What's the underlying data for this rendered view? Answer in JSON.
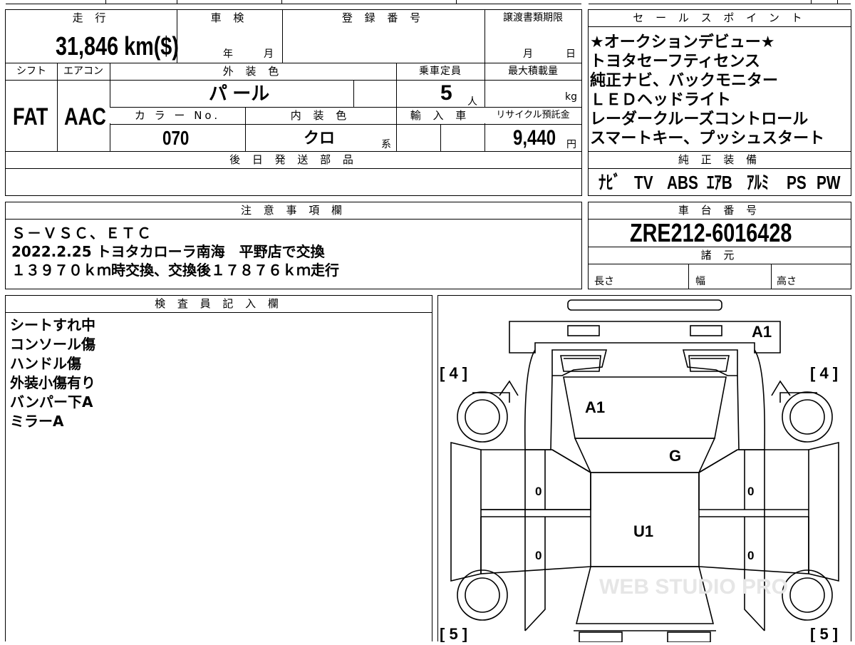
{
  "top": {
    "mileage_label": "走 行",
    "mileage_value": "31,846 km($)",
    "inspection_label": "車 検",
    "inspection_year": "年",
    "inspection_month": "月",
    "registration_label": "登 録 番 号",
    "transfer_label": "譲渡書類期限",
    "transfer_month": "月",
    "transfer_day": "日"
  },
  "row2": {
    "shift_label": "シフト",
    "ac_label": "エアコン",
    "exterior_color_label": "外 装 色",
    "capacity_label": "乗車定員",
    "max_load_label": "最大積載量",
    "shift_value": "FAT",
    "ac_value": "AAC",
    "exterior_color_value": "パ ール",
    "capacity_value": "5",
    "capacity_unit": "人",
    "max_load_unit": "kg",
    "color_no_label": "カ ラ ー No.",
    "interior_color_label": "内 装 色",
    "import_label": "輸 入 車",
    "recycle_label": "リサイクル預託金",
    "color_no_value": "070",
    "interior_color_value": "クロ",
    "interior_color_suffix": "系",
    "recycle_value": "9,440",
    "recycle_unit": "円",
    "later_parts_label": "後 日 発 送 部 品"
  },
  "sales": {
    "label": "セ ー ル ス ポ イ ン ト",
    "points": [
      "★オークションデビュー★",
      "トヨタセーフティセンス",
      "純正ナビ、バックモニター",
      "ＬＥＤヘッドライト",
      "レーダークルーズコントロール",
      "スマートキー、プッシュスタート"
    ],
    "equipment_label": "純 正 装 備",
    "equipment": [
      "ﾅﾋﾞ",
      "TV",
      "ABS",
      "ｴｱB",
      "ｱﾙﾐ",
      "PS",
      "PW"
    ]
  },
  "notes": {
    "label": "注 意 事 項 欄",
    "lines": [
      "Ｓ－ＶＳＣ、ＥＴＣ",
      "2022.2.25 トヨタカローラ南海　平野店で交換",
      "１３９７０ｋｍ時交換、交換後１７８７６ｋｍ走行"
    ]
  },
  "chassis": {
    "label": "車 台 番 号",
    "value": "ZRE212-6016428",
    "specs_label": "諸 元",
    "length_label": "長さ",
    "width_label": "幅",
    "height_label": "高さ"
  },
  "inspector": {
    "label": "検 査 員 記 入 欄",
    "lines": [
      "シートすれ中",
      "コンソール傷",
      "ハンドル傷",
      "外装小傷有り",
      "バンパー下A",
      "ミラーA"
    ]
  },
  "diagram": {
    "marks": {
      "front_bumper": "A1",
      "hood": "A1",
      "windshield": "G",
      "roof": "U1",
      "door_fl": "0",
      "door_rl": "0",
      "door_fr": "0",
      "door_rr": "0"
    },
    "tire_front_left": "[ 4 ]",
    "tire_front_right": "[ 4 ]",
    "tire_rear_left": "[ 5 ]",
    "tire_rear_right": "[ 5 ]",
    "watermark": "WEB STUDIO PRO"
  }
}
